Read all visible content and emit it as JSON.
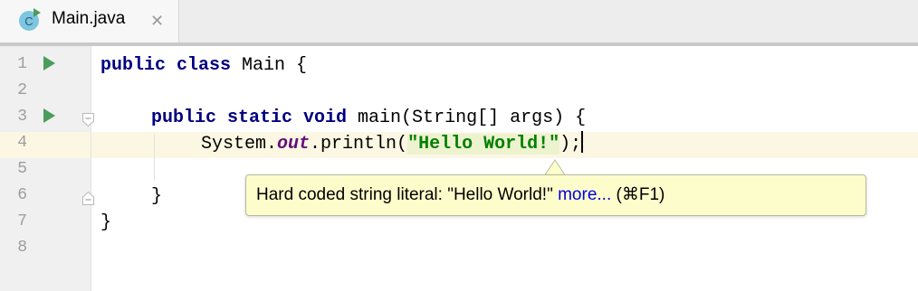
{
  "tab": {
    "label": "Main.java",
    "close": "✕",
    "icon": "java-class-run-icon",
    "icon_letter": "C"
  },
  "gutter": {
    "line_numbers": [
      "1",
      "2",
      "3",
      "4",
      "5",
      "6",
      "7",
      "8"
    ],
    "run_icon_lines": [
      1,
      3
    ],
    "fold_marker_lines": [
      3,
      6
    ],
    "current_line": 4
  },
  "code": {
    "line1": {
      "kw": "public class",
      "rest": " Main {"
    },
    "line3": {
      "kw": "public static void",
      "rest": " main(String[] args) {"
    },
    "line4": {
      "pre": "System.",
      "field": "out",
      "mid": ".println(",
      "string": "\"Hello World!\"",
      "post": ");"
    },
    "line6": "}",
    "line7": "}"
  },
  "tooltip": {
    "message": "Hard coded string literal: \"Hello World!\" ",
    "link": "more...",
    "shortcut": " (⌘F1)"
  },
  "colors": {
    "keyword": "#000080",
    "field": "#660e7a",
    "string": "#008000",
    "string_highlight": "#edf2cf",
    "current_line": "#fcf7e3",
    "tooltip_bg": "#fdfdcc",
    "run_icon": "#4c9c5c",
    "link": "#0000e0"
  }
}
